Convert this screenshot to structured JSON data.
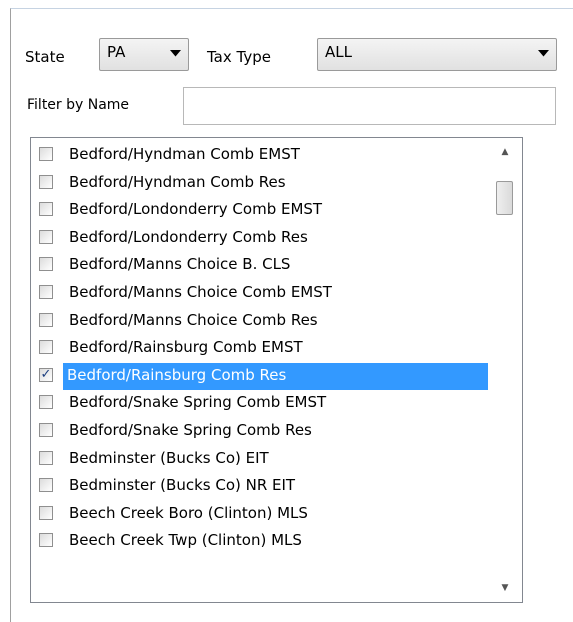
{
  "filters": {
    "state_label": "State",
    "state_value": "PA",
    "tax_type_label": "Tax Type",
    "tax_type_value": "ALL",
    "name_label": "Filter by Name",
    "name_value": ""
  },
  "icons": {
    "dropdown": "chevron-down-icon",
    "scroll_up": "scroll-up-arrow-icon",
    "scroll_down": "scroll-down-arrow-icon"
  },
  "colors": {
    "selection": "#3399ff",
    "selection_text": "#ffffff"
  },
  "list": {
    "items": [
      {
        "label": "Bedford/Hyndman Comb EMST",
        "checked": false,
        "selected": false
      },
      {
        "label": "Bedford/Hyndman Comb Res",
        "checked": false,
        "selected": false
      },
      {
        "label": "Bedford/Londonderry Comb EMST",
        "checked": false,
        "selected": false
      },
      {
        "label": "Bedford/Londonderry Comb Res",
        "checked": false,
        "selected": false
      },
      {
        "label": "Bedford/Manns Choice B. CLS",
        "checked": false,
        "selected": false
      },
      {
        "label": "Bedford/Manns Choice Comb EMST",
        "checked": false,
        "selected": false
      },
      {
        "label": "Bedford/Manns Choice Comb Res",
        "checked": false,
        "selected": false
      },
      {
        "label": "Bedford/Rainsburg Comb EMST",
        "checked": false,
        "selected": false
      },
      {
        "label": "Bedford/Rainsburg Comb Res",
        "checked": true,
        "selected": true
      },
      {
        "label": "Bedford/Snake Spring Comb EMST",
        "checked": false,
        "selected": false
      },
      {
        "label": "Bedford/Snake Spring Comb Res",
        "checked": false,
        "selected": false
      },
      {
        "label": "Bedminster (Bucks Co) EIT",
        "checked": false,
        "selected": false
      },
      {
        "label": "Bedminster (Bucks Co) NR EIT",
        "checked": false,
        "selected": false
      },
      {
        "label": "Beech Creek Boro (Clinton) MLS",
        "checked": false,
        "selected": false
      },
      {
        "label": "Beech Creek Twp (Clinton) MLS",
        "checked": false,
        "selected": false
      }
    ]
  }
}
